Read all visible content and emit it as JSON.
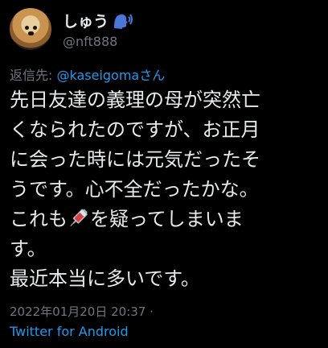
{
  "user": {
    "display_name": "しゅう",
    "handle": "@nft888"
  },
  "reply": {
    "prefix": "返信先: ",
    "mention": "@kaseigoma",
    "suffix": "さん"
  },
  "body": {
    "line1": "先日友達の義理の母が突然亡",
    "line2": "くなられたのですが、お正月",
    "line3": "に会った時には元気だったそ",
    "line4": "うです。心不全だったかな。",
    "line5_before": "これも",
    "line5_after": "を疑ってしまいま",
    "line6": "す。",
    "line7": "最近本当に多いです。"
  },
  "meta": {
    "timestamp": "2022年01月20日 20:37 ·",
    "source": "Twitter for Android"
  },
  "icons": {
    "avatar": "golden-retriever-avatar",
    "name_badge": "speaking-head-icon",
    "inline": "syringe-icon"
  },
  "colors": {
    "background": "#000000",
    "text": "#e7e9ea",
    "muted": "#71767b",
    "link": "#1d9bf0"
  }
}
